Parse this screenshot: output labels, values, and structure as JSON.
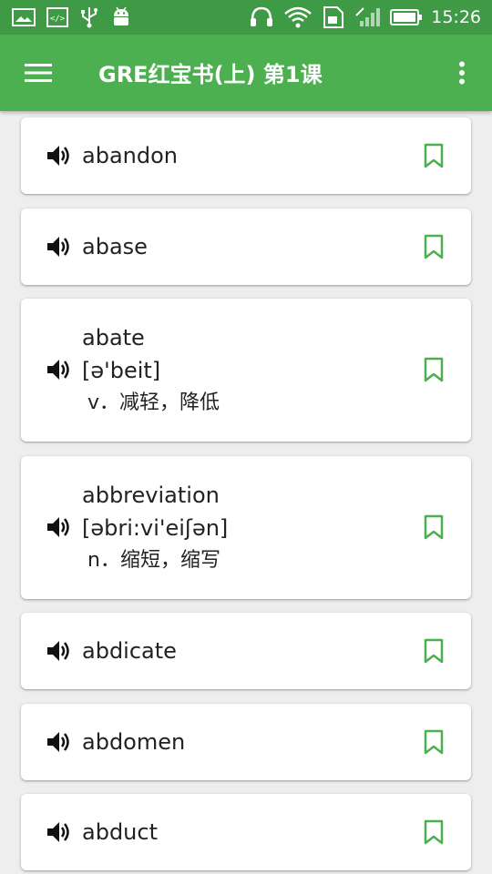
{
  "status_bar": {
    "time": "15:26",
    "icons": [
      "gallery-icon",
      "code-icon",
      "usb-icon",
      "android-icon",
      "headset-icon",
      "wifi-icon",
      "sim-icon",
      "signal-icon",
      "battery-icon"
    ]
  },
  "app_bar": {
    "menu_icon": "hamburger-menu-icon",
    "title": "GRE红宝书(上) 第1课",
    "overflow_icon": "more-vert-icon"
  },
  "colors": {
    "status_bar": "#3e9a44",
    "app_bar": "#4caf50",
    "accent": "#4caf50",
    "background": "#eeeeee"
  },
  "words": [
    {
      "word": "abandon",
      "phonetic": "",
      "meaning": ""
    },
    {
      "word": "abase",
      "phonetic": "",
      "meaning": ""
    },
    {
      "word": "abate",
      "phonetic": "[ə'beit]",
      "meaning": "v．减轻，降低"
    },
    {
      "word": "abbreviation",
      "phonetic": "[əbri:vi'eiʃən]",
      "meaning": "n．缩短，缩写"
    },
    {
      "word": "abdicate",
      "phonetic": "",
      "meaning": ""
    },
    {
      "word": "abdomen",
      "phonetic": "",
      "meaning": ""
    },
    {
      "word": "abduct",
      "phonetic": "",
      "meaning": ""
    }
  ]
}
